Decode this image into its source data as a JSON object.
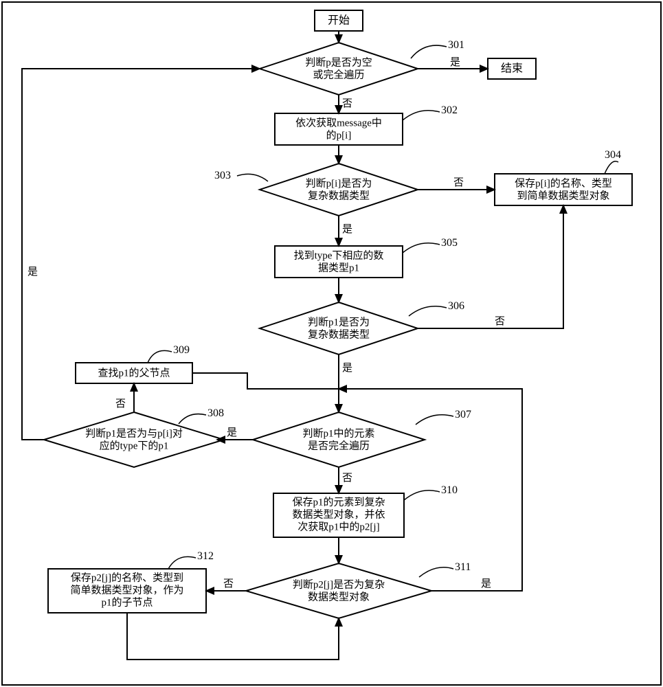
{
  "nodes": {
    "start": "开始",
    "end": "结束",
    "d301_l1": "判断p是否为空",
    "d301_l2": "或完全遍历",
    "p302_l1": "依次获取message中",
    "p302_l2": "的p[i]",
    "d303_l1": "判断p[i]是否为",
    "d303_l2": "复杂数据类型",
    "p304_l1": "保存p[i]的名称、类型",
    "p304_l2": "到简单数据类型对象",
    "p305_l1": "找到type下相应的数",
    "p305_l2": "据类型p1",
    "d306_l1": "判断p1是否为",
    "d306_l2": "复杂数据类型",
    "d307_l1": "判断p1中的元素",
    "d307_l2": "是否完全遍历",
    "d308_l1": "判断p1是否为与p[i]对",
    "d308_l2": "应的type下的p1",
    "p309": "查找p1的父节点",
    "p310_l1": "保存p1的元素到复杂",
    "p310_l2": "数据类型对象，并依",
    "p310_l3": "次获取p1中的p2[j]",
    "d311_l1": "判断p2[j]是否为复杂",
    "d311_l2": "数据类型对象",
    "p312_l1": "保存p2[j]的名称、类型到",
    "p312_l2": "简单数据类型对象，作为",
    "p312_l3": "p1的子节点"
  },
  "edges": {
    "yes": "是",
    "no": "否"
  },
  "refs": {
    "r301": "301",
    "r302": "302",
    "r303": "303",
    "r304": "304",
    "r305": "305",
    "r306": "306",
    "r307": "307",
    "r308": "308",
    "r309": "309",
    "r310": "310",
    "r311": "311",
    "r312": "312"
  }
}
